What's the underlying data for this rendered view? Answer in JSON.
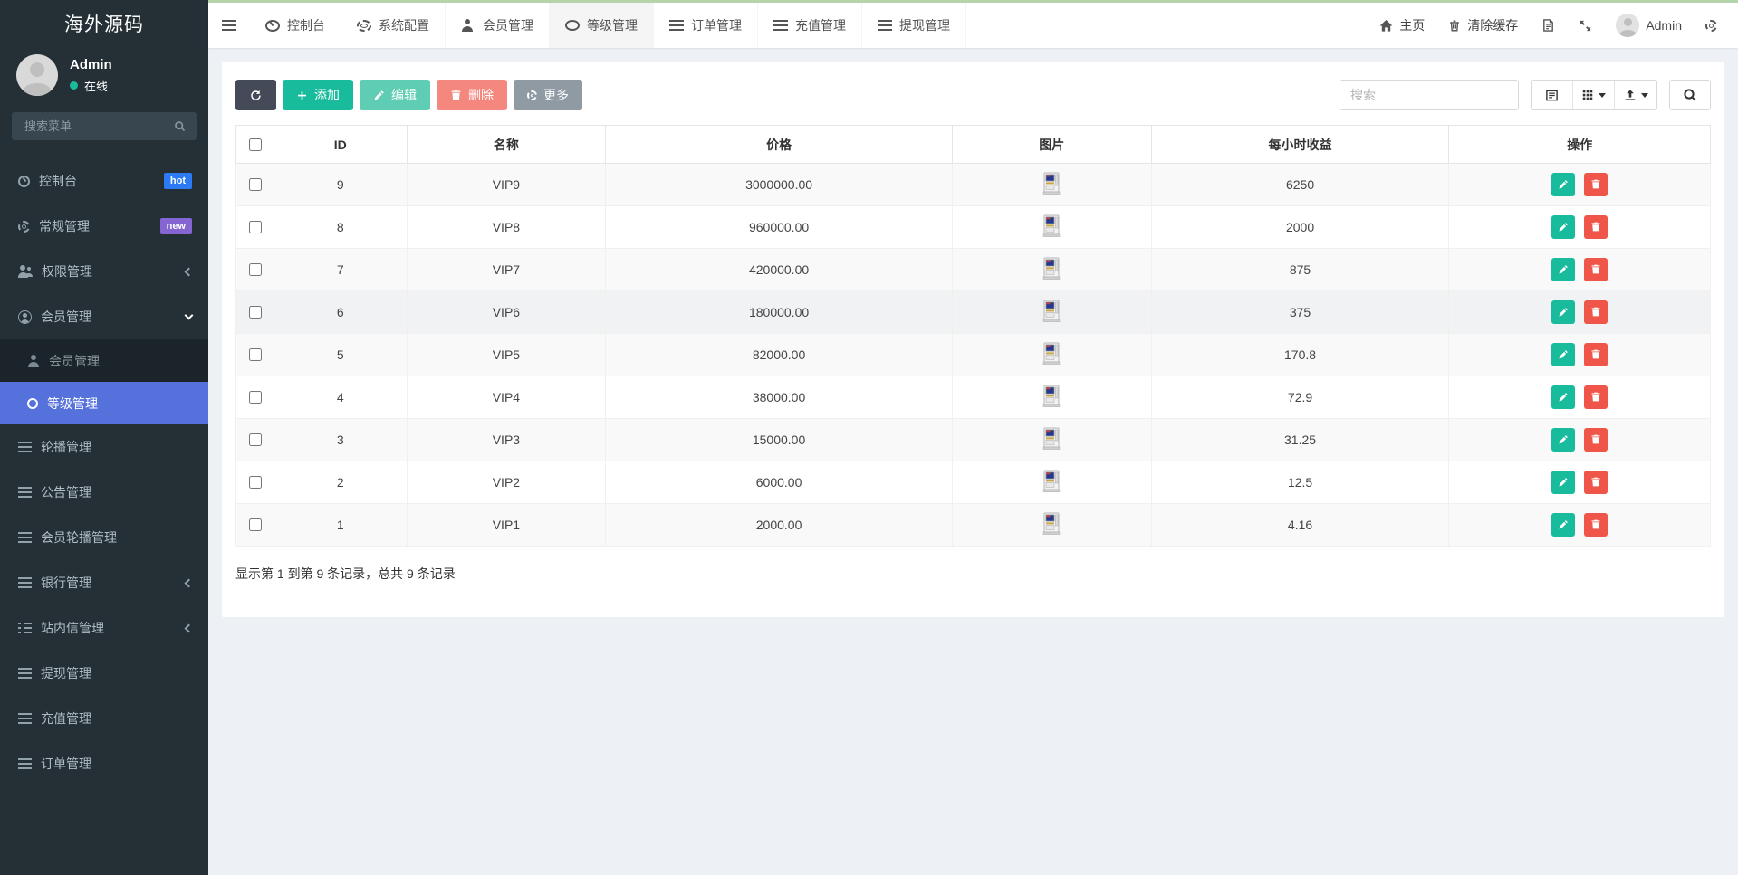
{
  "sidebar": {
    "title": "海外源码",
    "user": {
      "name": "Admin",
      "status": "在线"
    },
    "search_placeholder": "搜索菜单",
    "items": [
      {
        "label": "控制台",
        "icon": "gauge",
        "badge": "hot"
      },
      {
        "label": "常规管理",
        "icon": "gear",
        "badge": "new"
      },
      {
        "label": "权限管理",
        "icon": "users",
        "chevron": "left"
      },
      {
        "label": "会员管理",
        "icon": "user-circle",
        "chevron": "down"
      },
      {
        "label": "会员管理",
        "icon": "user",
        "sub": true
      },
      {
        "label": "等级管理",
        "icon": "ring",
        "sub": true,
        "active": true
      },
      {
        "label": "轮播管理",
        "icon": "bars"
      },
      {
        "label": "公告管理",
        "icon": "bars"
      },
      {
        "label": "会员轮播管理",
        "icon": "bars"
      },
      {
        "label": "银行管理",
        "icon": "bars",
        "chevron": "left"
      },
      {
        "label": "站内信管理",
        "icon": "bars-ul",
        "chevron": "left"
      },
      {
        "label": "提现管理",
        "icon": "bars"
      },
      {
        "label": "充值管理",
        "icon": "bars"
      },
      {
        "label": "订单管理",
        "icon": "bars"
      }
    ]
  },
  "navbar": {
    "menu_toggle_icon": "hamburger",
    "tabs": [
      {
        "label": "控制台",
        "icon": "gauge"
      },
      {
        "label": "系统配置",
        "icon": "gear"
      },
      {
        "label": "会员管理",
        "icon": "user"
      },
      {
        "label": "等级管理",
        "icon": "ring",
        "active": true
      },
      {
        "label": "订单管理",
        "icon": "bars"
      },
      {
        "label": "充值管理",
        "icon": "bars"
      },
      {
        "label": "提现管理",
        "icon": "bars"
      }
    ],
    "right": {
      "home_label": "主页",
      "clear_cache_label": "清除缓存",
      "language_icon": "document-language",
      "fullscreen_icon": "fullscreen-arrows",
      "user_name": "Admin",
      "settings_icon": "gears"
    }
  },
  "toolbar": {
    "refresh_icon": "refresh",
    "add_label": "添加",
    "edit_label": "编辑",
    "delete_label": "删除",
    "more_label": "更多",
    "search_placeholder": "搜索",
    "view_icons": [
      "detail-view",
      "columns-grid",
      "export"
    ]
  },
  "table": {
    "columns": [
      "ID",
      "名称",
      "价格",
      "图片",
      "每小时收益",
      "操作"
    ],
    "rows": [
      {
        "id": "9",
        "name": "VIP9",
        "price": "3000000.00",
        "image": "machine",
        "income": "6250"
      },
      {
        "id": "8",
        "name": "VIP8",
        "price": "960000.00",
        "image": "machine",
        "income": "2000"
      },
      {
        "id": "7",
        "name": "VIP7",
        "price": "420000.00",
        "image": "machine",
        "income": "875"
      },
      {
        "id": "6",
        "name": "VIP6",
        "price": "180000.00",
        "image": "machine",
        "income": "375",
        "hover": true
      },
      {
        "id": "5",
        "name": "VIP5",
        "price": "82000.00",
        "image": "machine",
        "income": "170.8"
      },
      {
        "id": "4",
        "name": "VIP4",
        "price": "38000.00",
        "image": "machine",
        "income": "72.9"
      },
      {
        "id": "3",
        "name": "VIP3",
        "price": "15000.00",
        "image": "machine",
        "income": "31.25"
      },
      {
        "id": "2",
        "name": "VIP2",
        "price": "6000.00",
        "image": "machine",
        "income": "12.5"
      },
      {
        "id": "1",
        "name": "VIP1",
        "price": "2000.00",
        "image": "machine",
        "income": "4.16"
      }
    ],
    "footer_text": "显示第 1 到第 9 条记录，总共 9 条记录"
  },
  "colors": {
    "sidebar_bg": "#242f36",
    "submenu_bg": "#1b242a",
    "active_item": "#5571db",
    "topbar_strip": "#b6d4ac",
    "badge_hot": "#2d7bf4",
    "badge_new": "#8465d1",
    "btn_refresh": "#444a58",
    "btn_add": "#18bc9c",
    "btn_edit_disabled": "#5fcdb4",
    "btn_delete_disabled": "#f4887e",
    "btn_more": "#8f9aa3",
    "row_edit": "#18bc9c",
    "row_delete": "#ef5549",
    "online_status": "#18bc9c"
  }
}
